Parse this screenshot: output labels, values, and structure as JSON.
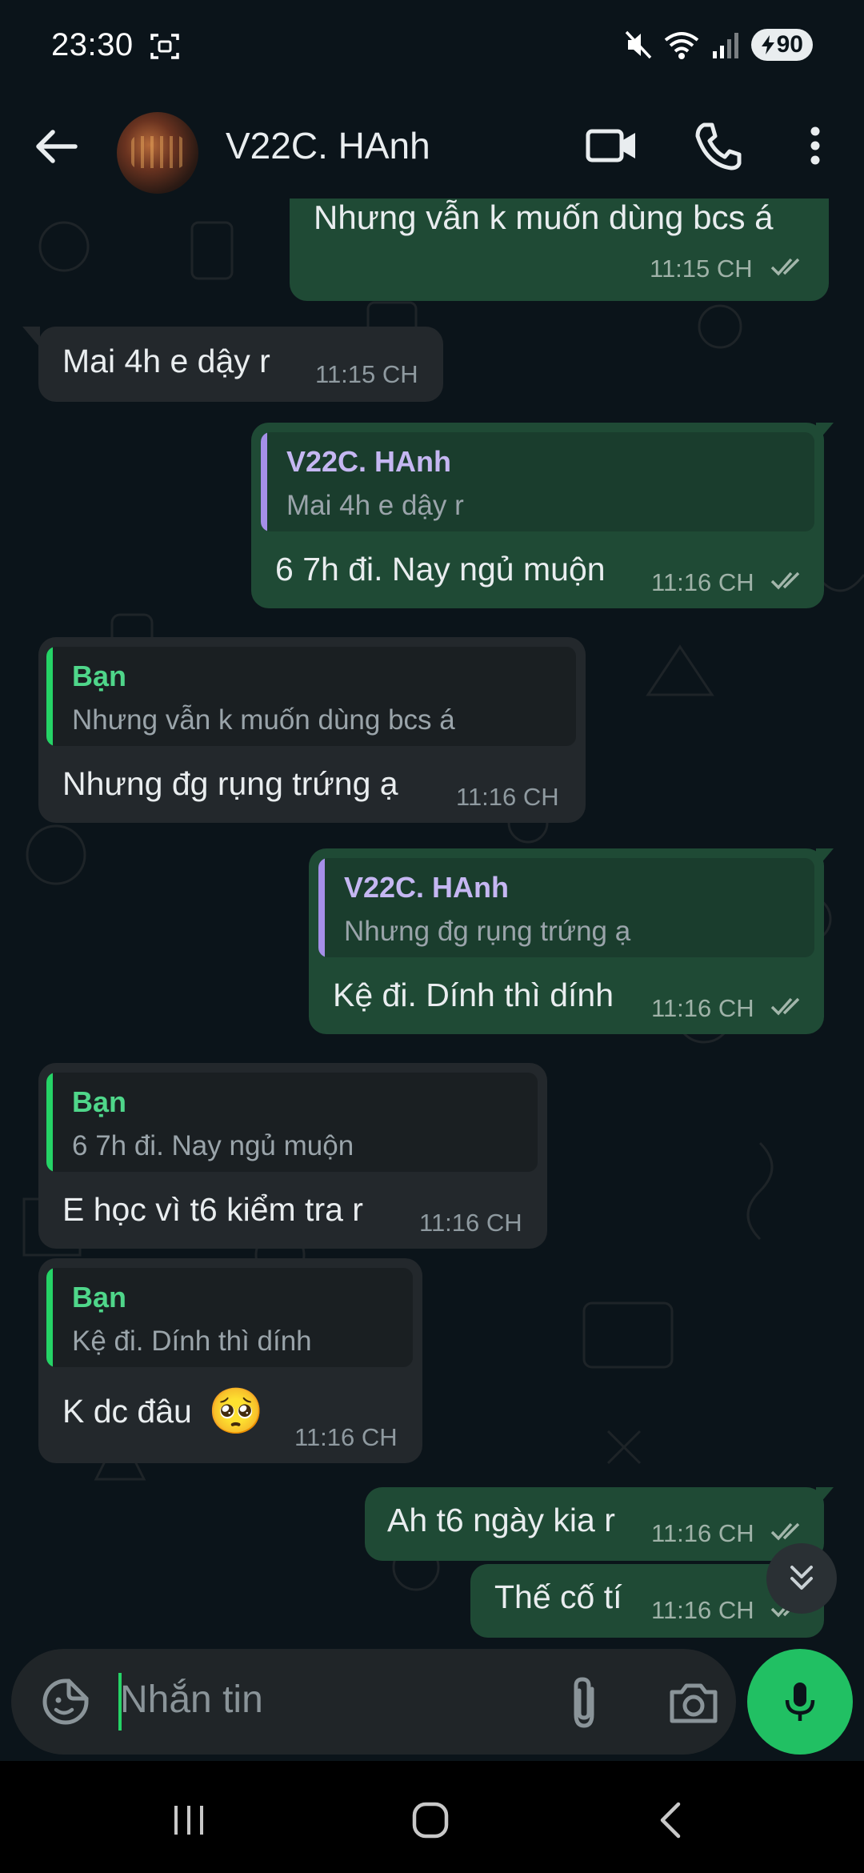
{
  "status_bar": {
    "time": "23:30",
    "battery": "90"
  },
  "header": {
    "contact_name": "V22C. HAnh"
  },
  "messages": [
    {
      "text": "Nhưng vẫn k muốn dùng bcs á",
      "time": "11:15 CH"
    },
    {
      "text": "Mai 4h e dậy r",
      "time": "11:15 CH"
    },
    {
      "quote_name": "V22C. HAnh",
      "quote_text": "Mai 4h e dậy r",
      "text": "6 7h đi. Nay ngủ muộn",
      "time": "11:16 CH"
    },
    {
      "quote_name": "Bạn",
      "quote_text": "Nhưng vẫn k muốn dùng bcs á",
      "text": "Nhưng đg rụng trứng ạ",
      "time": "11:16 CH"
    },
    {
      "quote_name": "V22C. HAnh",
      "quote_text": "Nhưng đg rụng trứng ạ",
      "text": "Kệ đi. Dính thì dính",
      "time": "11:16 CH"
    },
    {
      "quote_name": "Bạn",
      "quote_text": "6 7h đi. Nay ngủ muộn",
      "text": "E học vì t6 kiểm tra r",
      "time": "11:16 CH"
    },
    {
      "quote_name": "Bạn",
      "quote_text": "Kệ đi. Dính thì dính",
      "text": "K dc đâu",
      "emoji": "🥺",
      "time": "11:16 CH"
    },
    {
      "text": "Ah t6 ngày kia r",
      "time": "11:16 CH"
    },
    {
      "text": "Thế cố tí",
      "time": "11:16 CH"
    }
  ],
  "input": {
    "placeholder": "Nhắn tin"
  },
  "colors": {
    "outgoing_bubble": "#1f4a35",
    "incoming_bubble": "#23282c",
    "quote_accent_contact": "#a58fe8",
    "quote_accent_self": "#25d366",
    "mic_button": "#21c063"
  }
}
